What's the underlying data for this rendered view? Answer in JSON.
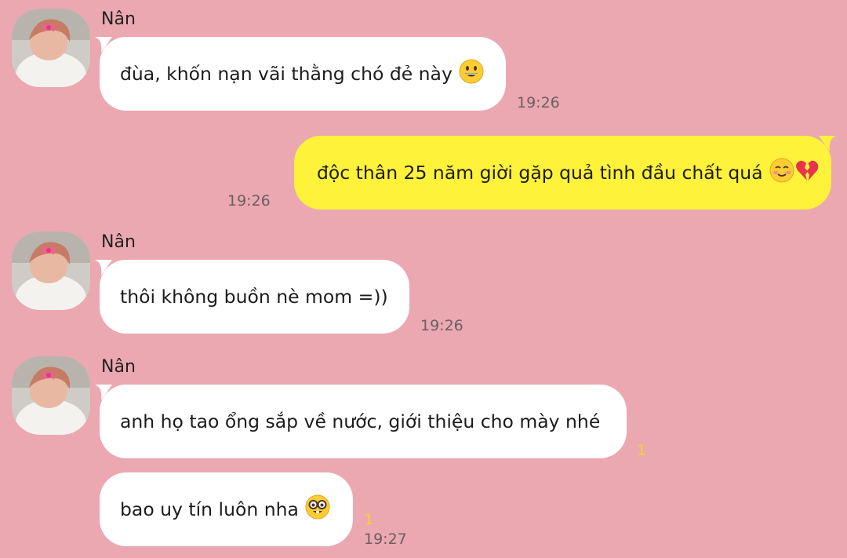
{
  "theme": {
    "background": "#eba8b1",
    "incoming_bubble": "#ffffff",
    "outgoing_bubble": "#fff23a",
    "read_count_color": "#f5d327"
  },
  "messages": [
    {
      "sender": "Nân",
      "text": "đùa, khốn nạn vãi thằng chó đẻ này",
      "emoji": "grinning-face-emoji",
      "time": "19:26"
    },
    {
      "text": "độc thân 25 năm giời gặp quả tình đầu chất quá",
      "emoji": "smiling-blush-and-broken-heart-emoji",
      "time": "19:26"
    },
    {
      "sender": "Nân",
      "text": "thôi không buồn nè mom =))",
      "time": "19:26"
    },
    {
      "sender": "Nân",
      "text": "anh họ tao ổng sắp về nước, giới thiệu cho mày nhé",
      "read": "1"
    },
    {
      "text": "bao uy tín luôn nha",
      "emoji": "nerd-face-emoji",
      "read": "1",
      "time": "19:27"
    }
  ]
}
